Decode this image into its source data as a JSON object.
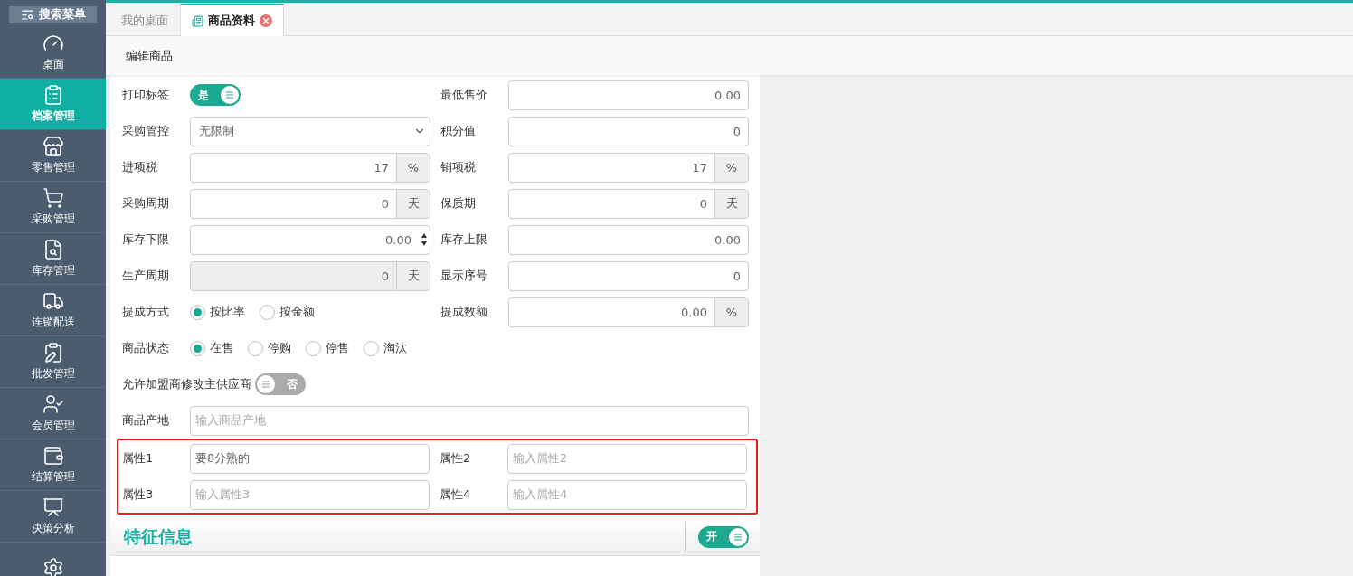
{
  "sidebar": {
    "search_button": "搜索菜单",
    "items": [
      {
        "label": "桌面",
        "selected": false
      },
      {
        "label": "档案管理",
        "selected": true
      },
      {
        "label": "零售管理",
        "selected": false
      },
      {
        "label": "采购管理",
        "selected": false
      },
      {
        "label": "库存管理",
        "selected": false
      },
      {
        "label": "连锁配送",
        "selected": false
      },
      {
        "label": "批发管理",
        "selected": false
      },
      {
        "label": "会员管理",
        "selected": false
      },
      {
        "label": "结算管理",
        "selected": false
      },
      {
        "label": "决策分析",
        "selected": false
      }
    ]
  },
  "tabs": [
    {
      "label": "我的桌面",
      "selected": false,
      "closable": false
    },
    {
      "label": "商品资料",
      "selected": true,
      "closable": true
    }
  ],
  "page_title": "编辑商品",
  "form": {
    "rows": [
      {
        "fields": [
          {
            "label": "打印标签",
            "kind": "toggle",
            "on": true,
            "text": "是"
          },
          {
            "label": "最低售价",
            "kind": "number",
            "value": "0.00"
          }
        ]
      },
      {
        "fields": [
          {
            "label": "采购管控",
            "kind": "select",
            "value": "无限制"
          },
          {
            "label": "积分值",
            "kind": "number",
            "value": "0"
          }
        ]
      },
      {
        "fields": [
          {
            "label": "进项税",
            "kind": "number",
            "value": "17",
            "unit": "%"
          },
          {
            "label": "销项税",
            "kind": "number",
            "value": "17",
            "unit": "%"
          }
        ]
      },
      {
        "fields": [
          {
            "label": "采购周期",
            "kind": "number",
            "value": "0",
            "unit": "天"
          },
          {
            "label": "保质期",
            "kind": "number",
            "value": "0",
            "unit": "天"
          }
        ]
      },
      {
        "fields": [
          {
            "label": "库存下限",
            "kind": "spin",
            "value": "0.00"
          },
          {
            "label": "库存上限",
            "kind": "number",
            "value": "0.00"
          }
        ]
      },
      {
        "fields": [
          {
            "label": "生产周期",
            "kind": "number",
            "value": "0",
            "unit": "天",
            "disabled": true
          },
          {
            "label": "显示序号",
            "kind": "number",
            "value": "0"
          }
        ]
      },
      {
        "fields": [
          {
            "label": "提成方式",
            "kind": "radios",
            "options": [
              {
                "label": "按比率",
                "selected": true
              },
              {
                "label": "按金额",
                "selected": false
              }
            ]
          },
          {
            "label": "提成数额",
            "kind": "number",
            "value": "0.00",
            "unit": "%"
          }
        ]
      },
      {
        "fields": [
          {
            "label": "商品状态",
            "kind": "radios",
            "options": [
              {
                "label": "在售",
                "selected": true
              },
              {
                "label": "停购",
                "selected": false
              },
              {
                "label": "停售",
                "selected": false
              },
              {
                "label": "淘汰",
                "selected": false
              }
            ]
          }
        ]
      },
      {
        "fields": [
          {
            "label": "允许加盟商修改主供应商",
            "kind": "toggle",
            "on": false,
            "text": "否"
          }
        ]
      },
      {
        "fields": [
          {
            "label": "商品产地",
            "kind": "text",
            "placeholder": "输入商品产地"
          }
        ]
      }
    ],
    "attribute_rows": [
      {
        "fields": [
          {
            "label": "属性1",
            "kind": "text",
            "value": "要8分熟的"
          },
          {
            "label": "属性2",
            "kind": "text",
            "placeholder": "输入属性2"
          }
        ]
      },
      {
        "fields": [
          {
            "label": "属性3",
            "kind": "text",
            "placeholder": "输入属性3"
          },
          {
            "label": "属性4",
            "kind": "text",
            "placeholder": "输入属性4"
          }
        ]
      }
    ]
  },
  "feature_section": {
    "title": "特征信息",
    "toggle": {
      "on": true,
      "text": "开"
    }
  }
}
